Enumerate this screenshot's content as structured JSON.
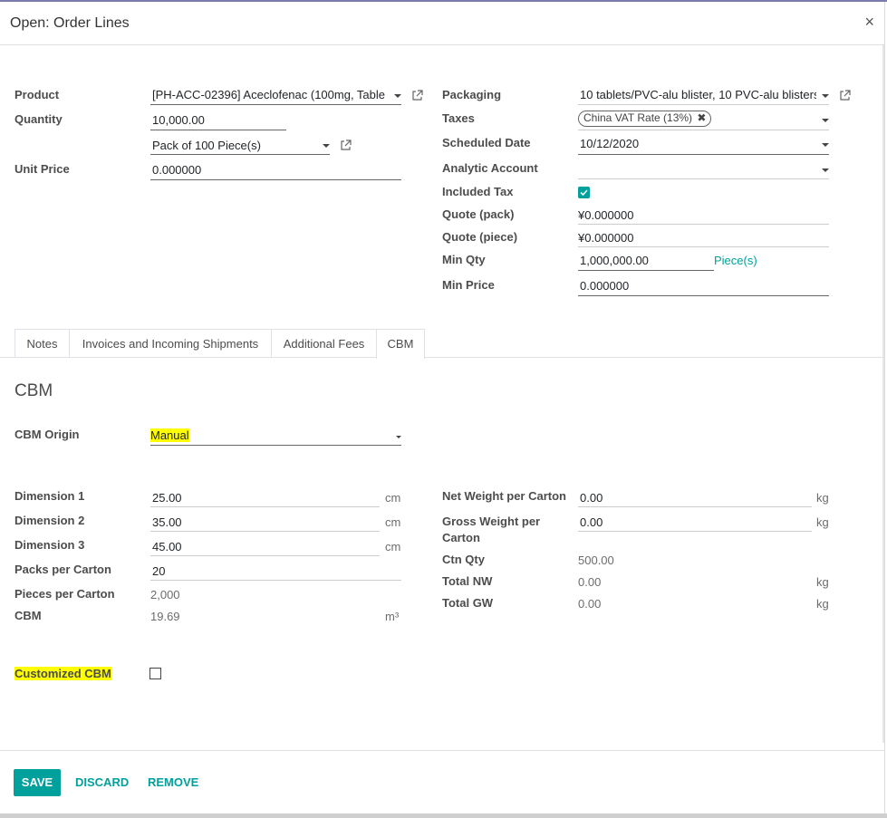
{
  "dialog": {
    "title": "Open: Order Lines",
    "close_label": "×"
  },
  "left": {
    "product_label": "Product",
    "product_value": "[PH-ACC-02396] Aceclofenac (100mg, Tablet",
    "quantity_label": "Quantity",
    "quantity_value": "10,000.00",
    "uom_value": "Pack of 100 Piece(s)",
    "unit_price_label": "Unit Price",
    "unit_price_value": "0.000000"
  },
  "right": {
    "packaging_label": "Packaging",
    "packaging_value": "10 tablets/PVC-alu blister, 10 PVC-alu blisters",
    "taxes_label": "Taxes",
    "taxes_tag": "China VAT Rate (13%)",
    "scheduled_date_label": "Scheduled Date",
    "scheduled_date_value": "10/12/2020",
    "analytic_account_label": "Analytic Account",
    "analytic_account_value": "",
    "included_tax_label": "Included Tax",
    "quote_pack_label": "Quote (pack)",
    "quote_pack_value": "¥0.000000",
    "quote_piece_label": "Quote (piece)",
    "quote_piece_value": "¥0.000000",
    "min_qty_label": "Min Qty",
    "min_qty_value": "1,000,000.00",
    "min_qty_unit": "Piece(s)",
    "min_price_label": "Min Price",
    "min_price_value": "0.000000"
  },
  "tabs": [
    {
      "label": "Notes"
    },
    {
      "label": "Invoices and Incoming Shipments"
    },
    {
      "label": "Additional Fees"
    },
    {
      "label": "CBM"
    }
  ],
  "cbm": {
    "section_title": "CBM",
    "origin_label": "CBM Origin",
    "origin_value": "Manual",
    "dim1_label": "Dimension 1",
    "dim1_value": "25.00",
    "dim2_label": "Dimension 2",
    "dim2_value": "35.00",
    "dim3_label": "Dimension 3",
    "dim3_value": "45.00",
    "dim_unit": "cm",
    "packs_per_carton_label": "Packs per Carton",
    "packs_per_carton_value": "20",
    "pieces_per_carton_label": "Pieces per Carton",
    "pieces_per_carton_value": "2,000",
    "cbm_label": "CBM",
    "cbm_value": "19.69",
    "cbm_unit": "m³",
    "net_weight_label": "Net Weight per Carton",
    "net_weight_value": "0.00",
    "gross_weight_label_1": "Gross Weight per",
    "gross_weight_label_2": "Carton",
    "gross_weight_value": "0.00",
    "weight_unit": "kg",
    "ctn_qty_label": "Ctn Qty",
    "ctn_qty_value": "500.00",
    "total_nw_label": "Total NW",
    "total_nw_value": "0.00",
    "total_gw_label": "Total GW",
    "total_gw_value": "0.00",
    "customized_label": "Customized CBM"
  },
  "footer": {
    "save_label": "SAVE",
    "discard_label": "DISCARD",
    "remove_label": "REMOVE"
  },
  "colors": {
    "accent": "#00a09d",
    "highlight": "#ffff00"
  }
}
